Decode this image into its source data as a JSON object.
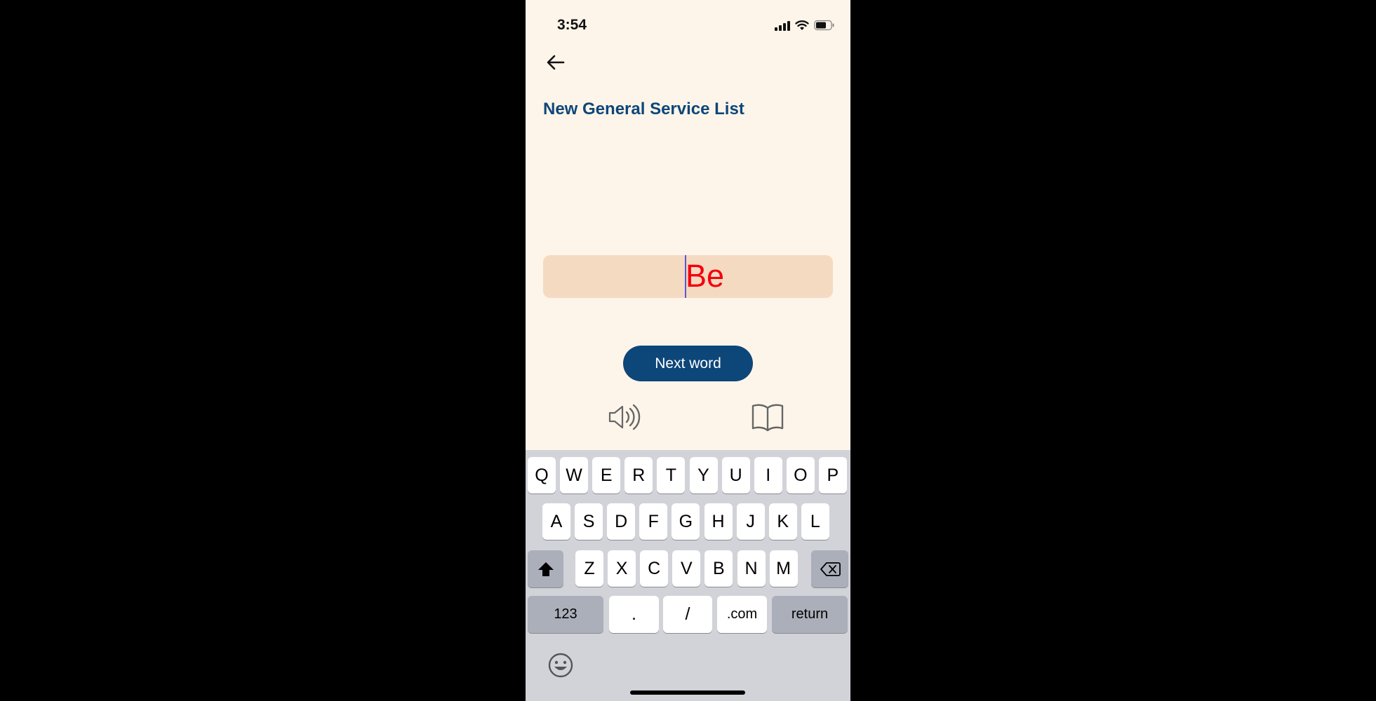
{
  "status_bar": {
    "time": "3:54"
  },
  "header": {
    "title": "New General Service List"
  },
  "answer_field": {
    "value": "Be"
  },
  "actions": {
    "next_word_label": "Next word"
  },
  "icons": {
    "back": "arrow-left-icon",
    "speaker": "speaker-icon",
    "book": "book-icon",
    "emoji": "emoji-icon",
    "shift": "shift-icon",
    "delete": "delete-icon"
  },
  "keyboard": {
    "row1": [
      "Q",
      "W",
      "E",
      "R",
      "T",
      "Y",
      "U",
      "I",
      "O",
      "P"
    ],
    "row2": [
      "A",
      "S",
      "D",
      "F",
      "G",
      "H",
      "J",
      "K",
      "L"
    ],
    "row3": [
      "Z",
      "X",
      "C",
      "V",
      "B",
      "N",
      "M"
    ],
    "numbers_label": "123",
    "dot_label": ".",
    "slash_label": "/",
    "dotcom_label": ".com",
    "return_label": "return"
  },
  "colors": {
    "background": "#fdf5e9",
    "accent": "#0d4679",
    "answer_bg": "#f5dac2",
    "answer_text": "#f5000b"
  }
}
